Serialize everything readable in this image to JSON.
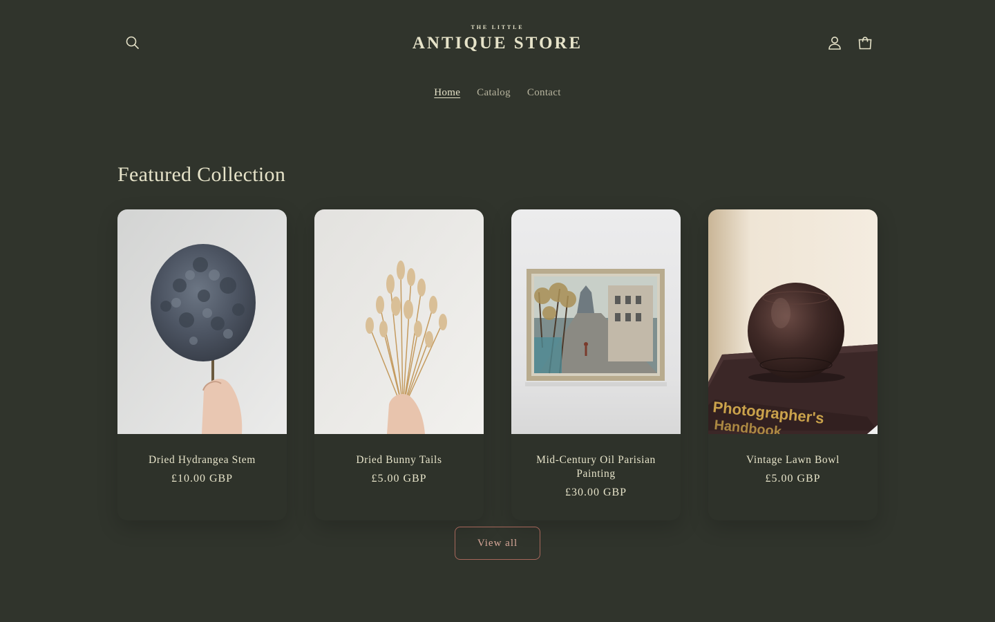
{
  "header": {
    "logo_small": "THE LITTLE",
    "logo_big": "ANTIQUE STORE",
    "search_icon": "search-icon",
    "account_icon": "user-icon",
    "cart_icon": "shopping-bag-icon"
  },
  "nav": {
    "items": [
      {
        "label": "Home",
        "active": true
      },
      {
        "label": "Catalog",
        "active": false
      },
      {
        "label": "Contact",
        "active": false
      }
    ]
  },
  "featured": {
    "title": "Featured Collection",
    "products": [
      {
        "name": "Dried Hydrangea Stem",
        "price": "£10.00 GBP"
      },
      {
        "name": "Dried Bunny Tails",
        "price": "£5.00 GBP"
      },
      {
        "name": "Mid-Century Oil Parisian Painting",
        "price": "£30.00 GBP"
      },
      {
        "name": "Vintage Lawn Bowl",
        "price": "£5.00 GBP"
      }
    ],
    "view_all_label": "View all"
  },
  "colors": {
    "background": "#30342c",
    "text": "#e6e3c9",
    "button_border": "#a7675b",
    "button_text": "#d9a899"
  }
}
